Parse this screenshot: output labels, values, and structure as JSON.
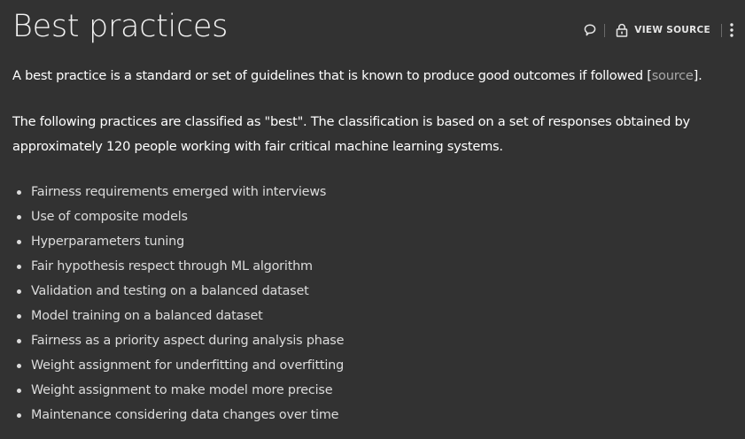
{
  "header": {
    "title": "Best practices",
    "toolbar": {
      "comment_icon": "speech-bubble-icon",
      "lock_icon": "lock-icon",
      "view_source_label": "VIEW SOURCE",
      "more_icon": "vertical-ellipsis-icon"
    }
  },
  "intro": {
    "text_before": "A best practice is a standard or set of guidelines that is known to produce good outcomes if followed [",
    "link_label": "source",
    "text_after": "]."
  },
  "classification": {
    "text": "The following practices are classified as \"best\". The classification is based on a set of responses obtained by approximately 120 people working with fair critical machine learning systems."
  },
  "practices": [
    "Fairness requirements emerged with interviews",
    "Use of composite models",
    "Hyperparameters tuning",
    "Fair hypothesis respect through ML algorithm",
    "Validation and testing on a balanced dataset",
    "Model training on a balanced dataset",
    "Fairness as a priority aspect during analysis phase",
    "Weight assignment for underfitting and overfitting",
    "Weight assignment to make model more precise",
    "Maintenance considering data changes over time"
  ],
  "colors": {
    "background": "#323232",
    "text": "#ffffff",
    "list_text": "#dcdcdc",
    "link": "#a8a8a8"
  }
}
